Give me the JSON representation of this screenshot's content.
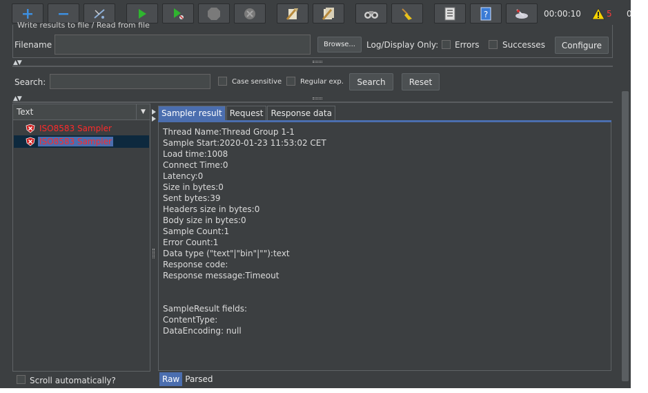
{
  "toolbar": {
    "buttons": [
      {
        "name": "add-icon",
        "color": "#3d8fe0"
      },
      {
        "name": "remove-icon",
        "color": "#3d8fe0"
      },
      {
        "name": "toggle-icon",
        "color": "#8fb0d8"
      },
      {
        "name": "start-icon",
        "color": "#2fb52f"
      },
      {
        "name": "start-no-pauses-icon",
        "color": "#2fb52f"
      },
      {
        "name": "stop-icon",
        "color": "#7a7a7a"
      },
      {
        "name": "shutdown-icon",
        "color": "#7a7a7a"
      },
      {
        "name": "clear-icon",
        "color": "#c9b27a"
      },
      {
        "name": "clear-all-icon",
        "color": "#c9b27a"
      },
      {
        "name": "search-icon",
        "color": "#cfcfcf"
      },
      {
        "name": "reset-search-icon",
        "color": "#e8c21a"
      },
      {
        "name": "function-helper-icon",
        "color": "#e0e0e0"
      },
      {
        "name": "help-icon",
        "color": "#3a7bd5"
      },
      {
        "name": "remote-icon",
        "color": "#cfcfd8"
      }
    ],
    "timer": "00:00:10",
    "warning_count": "5",
    "stray_text": "0"
  },
  "file_panel": {
    "cut_title": "Write results to file / Read from file",
    "filename_label": "Filename",
    "filename_value": "",
    "browse_label": "Browse...",
    "log_display_label": "Log/Display Only:",
    "errors_label": "Errors",
    "successes_label": "Successes",
    "configure_label": "Configure"
  },
  "search": {
    "label": "Search:",
    "value": "",
    "case_sensitive_label": "Case sensitive",
    "regex_label": "Regular exp.",
    "search_button": "Search",
    "reset_button": "Reset"
  },
  "tree": {
    "header": "Text",
    "items": [
      {
        "label": "ISO8583 Sampler",
        "selected": false
      },
      {
        "label": "ISO8583 Sampler",
        "selected": true
      }
    ],
    "scroll_auto_label": "Scroll automatically?"
  },
  "detail": {
    "tabs": [
      "Sampler result",
      "Request",
      "Response data"
    ],
    "active_tab": "Sampler result",
    "lines": [
      "Thread Name:Thread Group 1-1",
      "Sample Start:2020-01-23 11:53:02 CET",
      "Load time:1008",
      "Connect Time:0",
      "Latency:0",
      "Size in bytes:0",
      "Sent bytes:39",
      "Headers size in bytes:0",
      "Body size in bytes:0",
      "Sample Count:1",
      "Error Count:1",
      "Data type (\"text\"|\"bin\"|\"\"):text",
      "Response code:",
      "Response message:Timeout",
      "",
      "",
      "SampleResult fields:",
      "ContentType:",
      "DataEncoding: null"
    ],
    "bottom_tabs": [
      "Raw",
      "Parsed"
    ],
    "active_bottom_tab": "Raw"
  }
}
